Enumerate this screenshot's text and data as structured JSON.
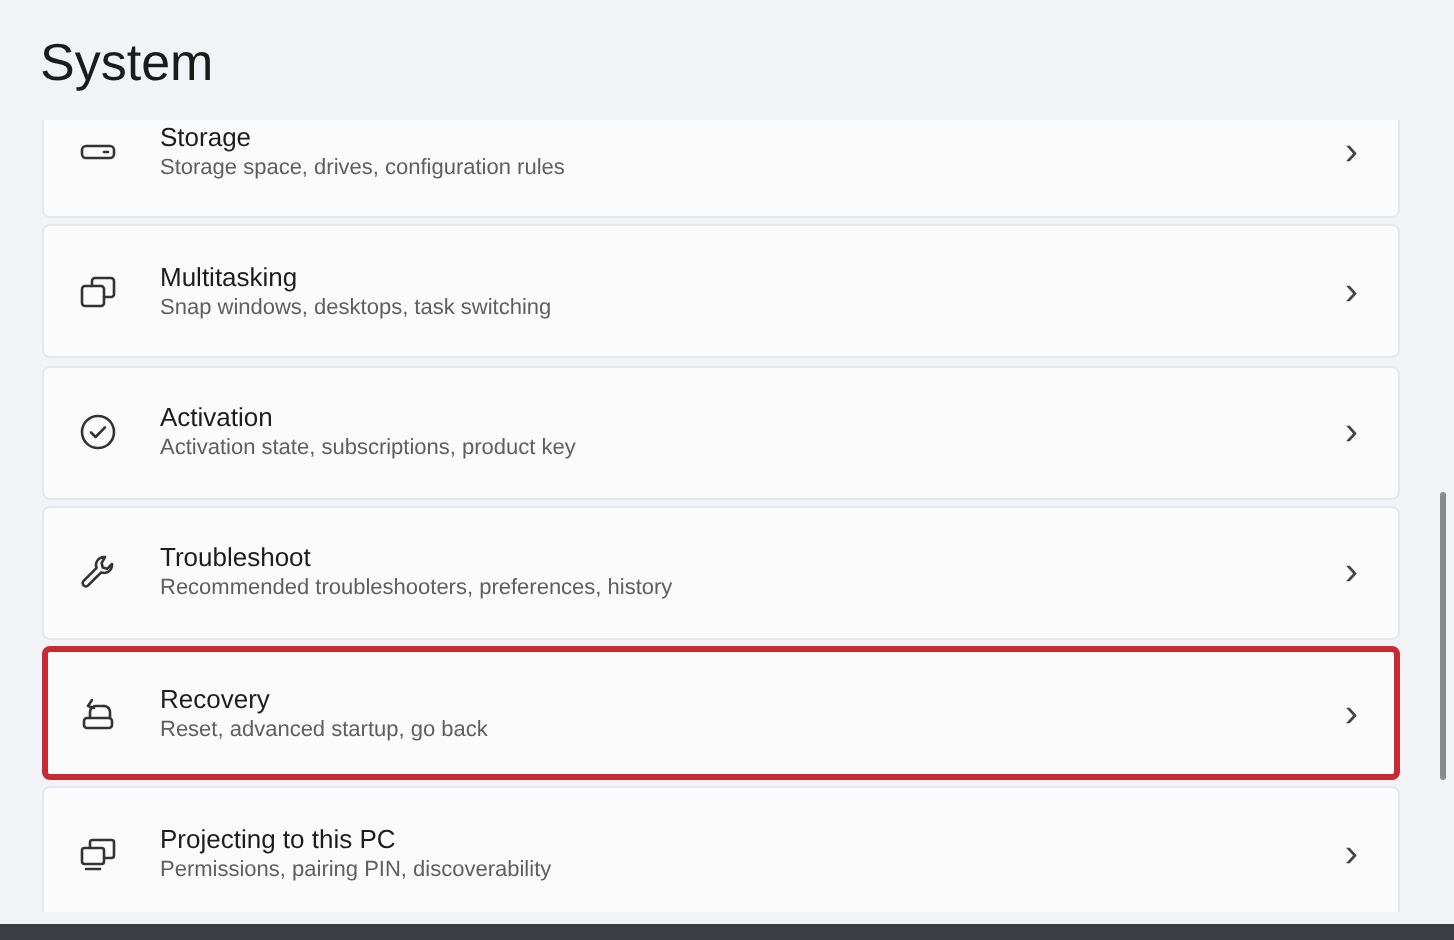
{
  "page_title": "System",
  "items": [
    {
      "title": "Storage",
      "subtitle": "Storage space, drives, configuration rules",
      "chevron": "›",
      "highlighted": false
    },
    {
      "title": "Multitasking",
      "subtitle": "Snap windows, desktops, task switching",
      "chevron": "›",
      "highlighted": false
    },
    {
      "title": "Activation",
      "subtitle": "Activation state, subscriptions, product key",
      "chevron": "›",
      "highlighted": false
    },
    {
      "title": "Troubleshoot",
      "subtitle": "Recommended troubleshooters, preferences, history",
      "chevron": "›",
      "highlighted": false
    },
    {
      "title": "Recovery",
      "subtitle": "Reset, advanced startup, go back",
      "chevron": "›",
      "highlighted": true
    },
    {
      "title": "Projecting to this PC",
      "subtitle": "Permissions, pairing PIN, discoverability",
      "chevron": "›",
      "highlighted": false
    }
  ]
}
